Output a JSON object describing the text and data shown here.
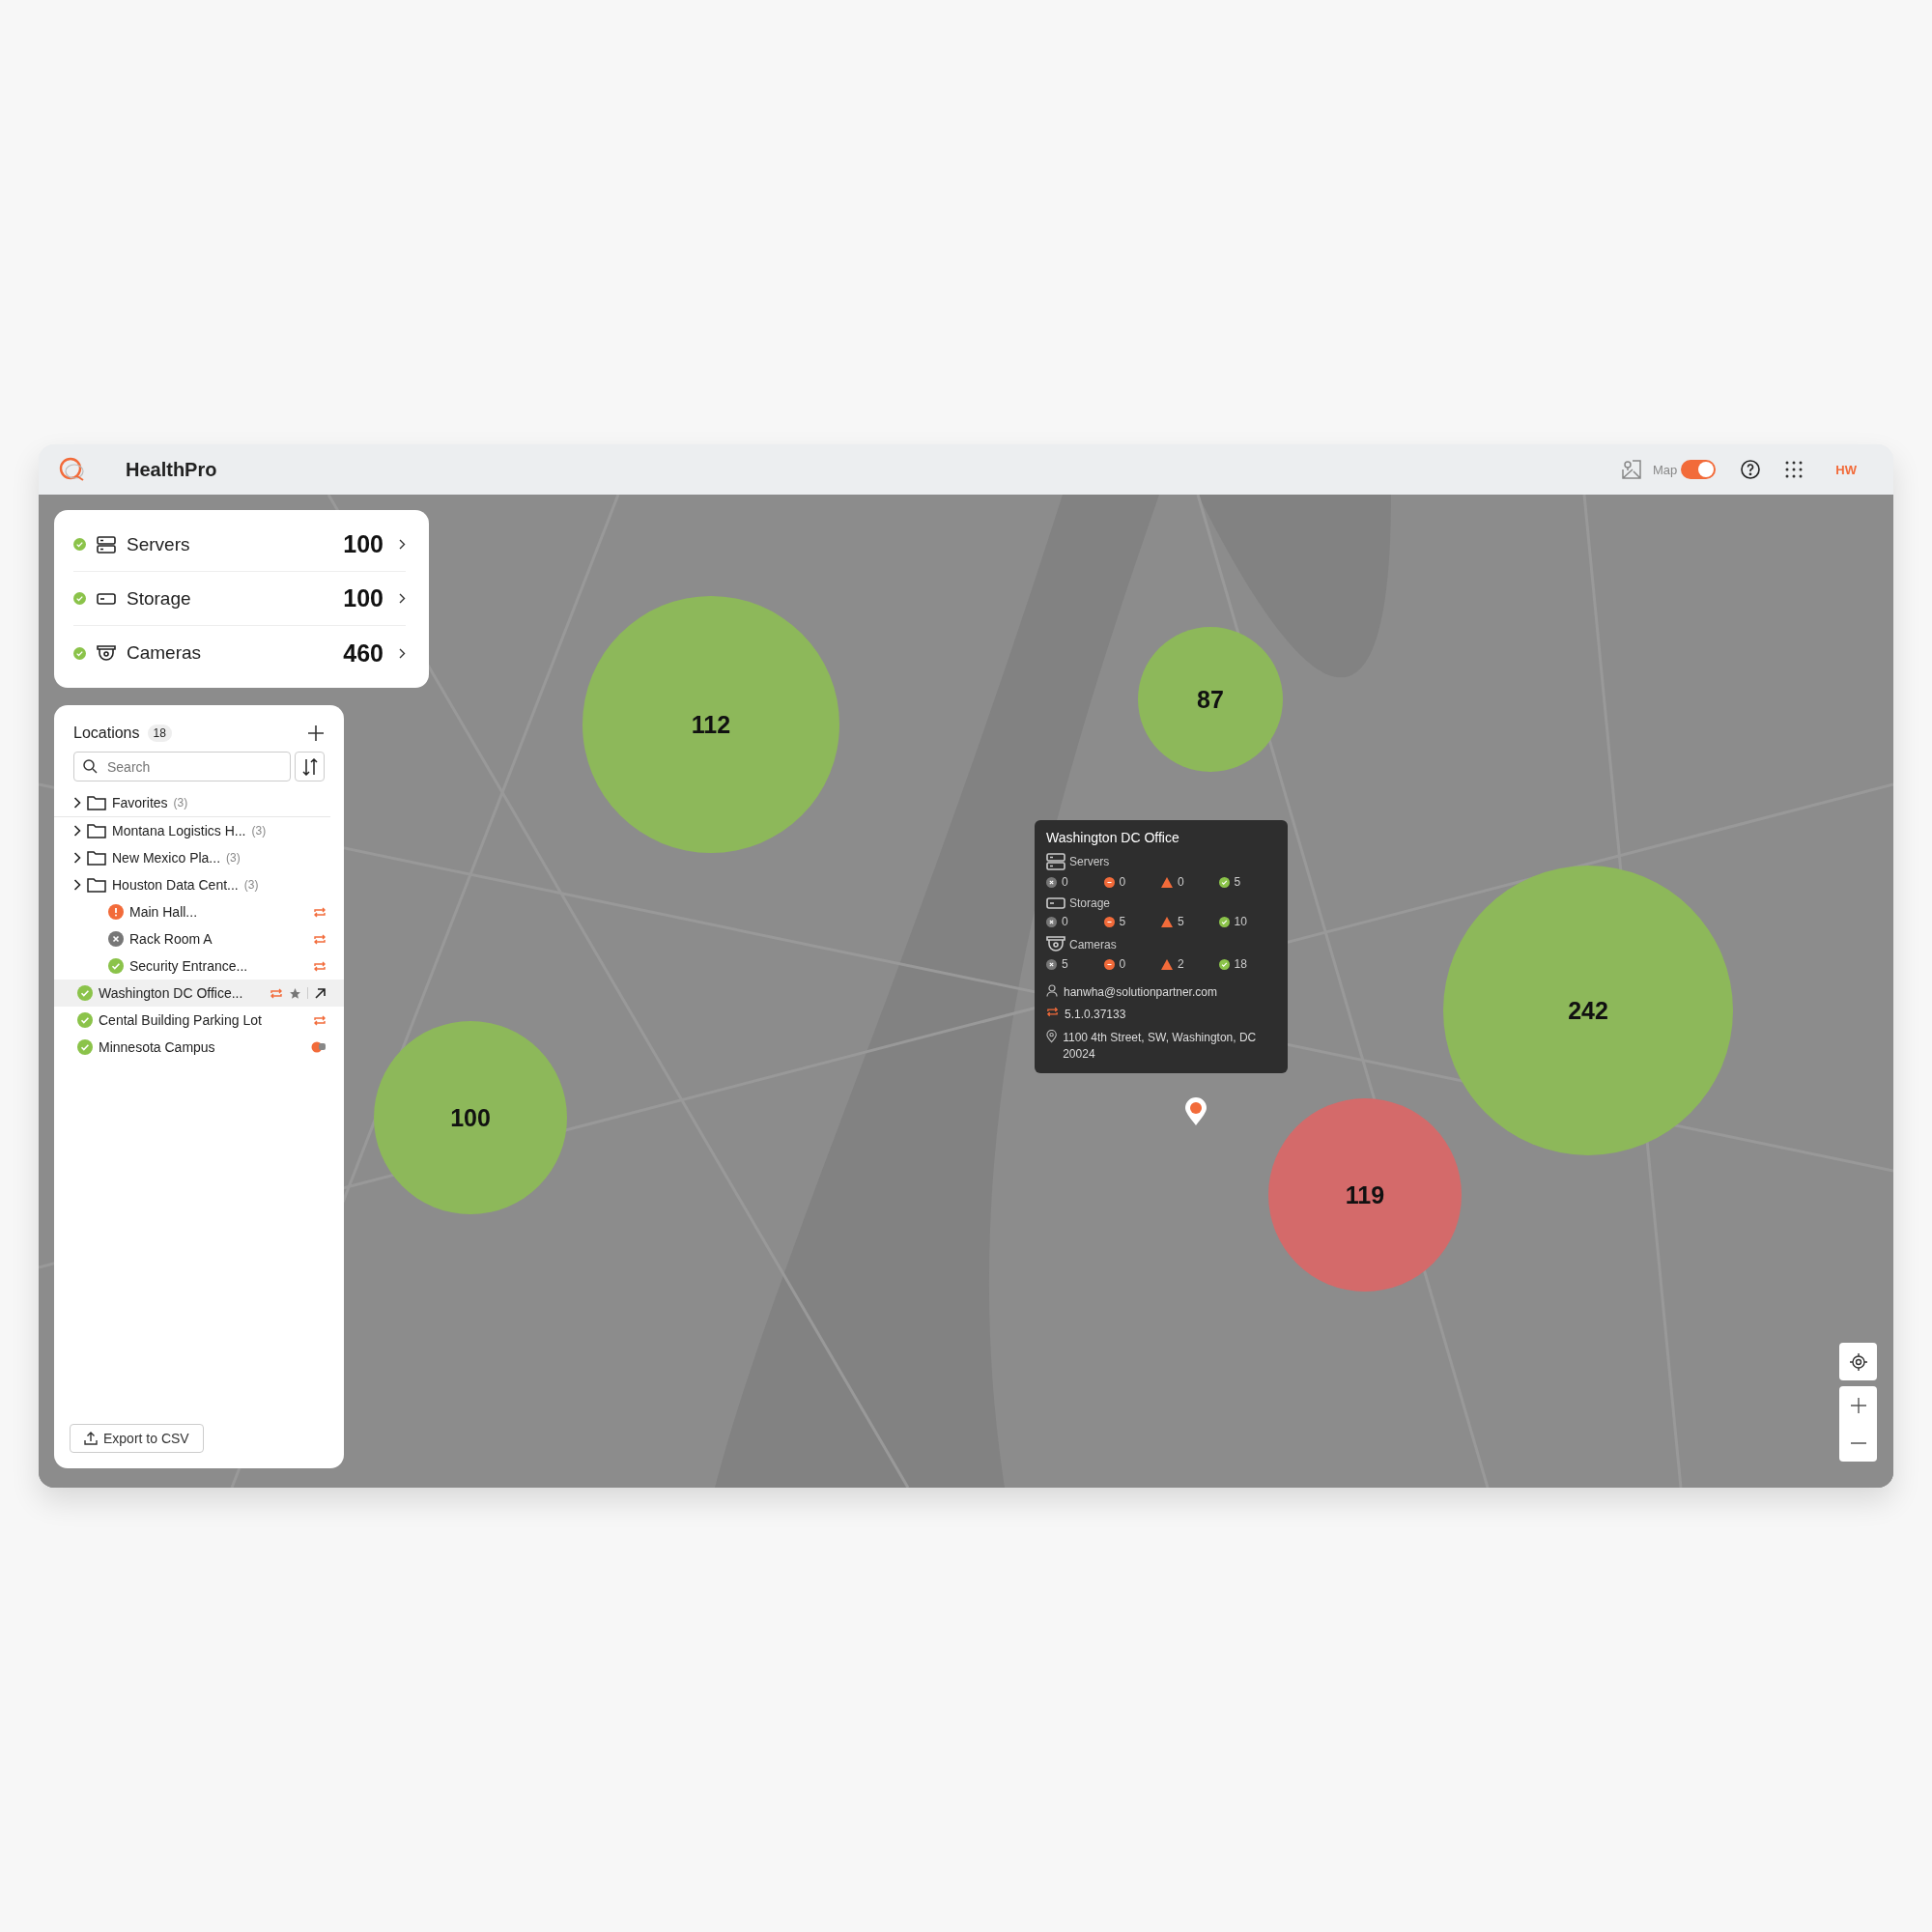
{
  "header": {
    "title": "HealthPro",
    "map_toggle": {
      "label": "Map",
      "on": true
    },
    "avatar": "HW"
  },
  "summary": [
    {
      "kind": "server",
      "label": "Servers",
      "value": "100",
      "status": {
        "kind": "ok"
      }
    },
    {
      "kind": "storage",
      "label": "Storage",
      "value": "100",
      "status": {
        "kind": "ok"
      }
    },
    {
      "kind": "camera",
      "label": "Cameras",
      "value": "460",
      "status": {
        "kind": "ok"
      }
    }
  ],
  "locations": {
    "title": "Locations",
    "count": "18",
    "search": {
      "placeholder": "Search"
    },
    "items": [
      {
        "kind": "folder",
        "name": "Favorites",
        "count": "(3)",
        "selected": false,
        "divider": true
      },
      {
        "kind": "folder",
        "name": "Montana Logistics H...",
        "count": "(3)",
        "selected": false,
        "divider": false
      },
      {
        "kind": "folder",
        "name": "New Mexico Pla...",
        "count": "(3)",
        "selected": false,
        "divider": false
      },
      {
        "kind": "folder",
        "name": "Houston Data Cent...",
        "count": "(3)",
        "selected": false,
        "divider": false,
        "children": [
          {
            "kind": "site",
            "name": "Main Hall...",
            "status": {
              "kind": "warning"
            },
            "badge": {
              "kind": "sync"
            },
            "selected": false
          },
          {
            "kind": "site",
            "name": "Rack Room A",
            "status": {
              "kind": "offline"
            },
            "badge": {
              "kind": "sync"
            },
            "selected": false
          },
          {
            "kind": "site",
            "name": "Security Entrance...",
            "status": {
              "kind": "ok"
            },
            "badge": {
              "kind": "sync"
            },
            "selected": false
          }
        ]
      },
      {
        "kind": "site",
        "name": "Washington DC Office...",
        "status": {
          "kind": "ok"
        },
        "badge": {
          "kind": "sync"
        },
        "selected": true
      },
      {
        "kind": "site",
        "name": "Cental Building Parking  Lot",
        "status": {
          "kind": "ok"
        },
        "badge": {
          "kind": "sync"
        },
        "selected": false
      },
      {
        "kind": "site",
        "name": "Minnesota Campus",
        "status": {
          "kind": "ok"
        },
        "badge": {
          "kind": "plug"
        },
        "selected": false
      }
    ],
    "export": "Export to CSV"
  },
  "map": {
    "clusters": [
      {
        "label": "112",
        "color": "#8db85a",
        "size": {
          "kind": "large"
        }
      },
      {
        "label": "87",
        "color": "#8db85a",
        "size": {
          "kind": "small"
        }
      },
      {
        "label": "242",
        "color": "#8db85a",
        "size": {
          "kind": "xlarge"
        }
      },
      {
        "label": "119",
        "color": "#d46a6a",
        "size": {
          "kind": "medium"
        }
      },
      {
        "label": "100",
        "color": "#8db85a",
        "size": {
          "kind": "medium"
        }
      }
    ],
    "tooltip": {
      "title": "Washington DC Office",
      "groups": [
        {
          "kind": "server",
          "label": "Servers",
          "stats": [
            {
              "kind": "offline",
              "value": "0"
            },
            {
              "kind": "error",
              "value": "0"
            },
            {
              "kind": "warning",
              "value": "0"
            },
            {
              "kind": "ok",
              "value": "5"
            }
          ]
        },
        {
          "kind": "storage",
          "label": "Storage",
          "stats": [
            {
              "kind": "offline",
              "value": "0"
            },
            {
              "kind": "error",
              "value": "5"
            },
            {
              "kind": "warning",
              "value": "5"
            },
            {
              "kind": "ok",
              "value": "10"
            }
          ]
        },
        {
          "kind": "camera",
          "label": "Cameras",
          "stats": [
            {
              "kind": "offline",
              "value": "5"
            },
            {
              "kind": "error",
              "value": "0"
            },
            {
              "kind": "warning",
              "value": "2"
            },
            {
              "kind": "ok",
              "value": "18"
            }
          ]
        }
      ],
      "user": "hanwha@solutionpartner.com",
      "version": "5.1.0.37133",
      "address": "1100 4th Street, SW, Washington, DC 20024"
    }
  }
}
